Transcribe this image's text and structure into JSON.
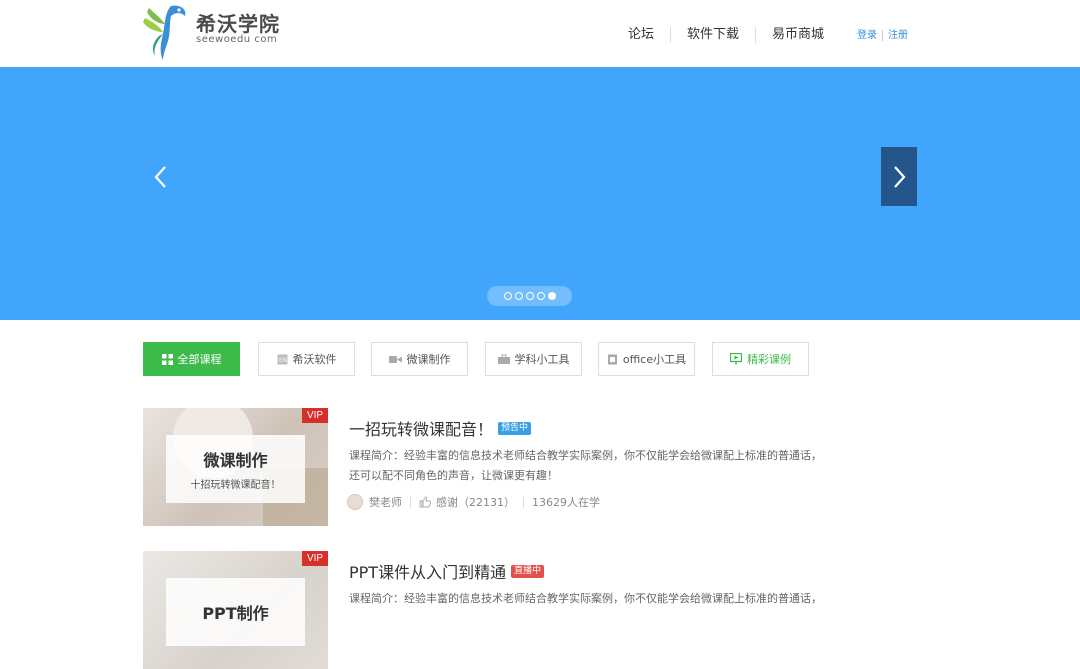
{
  "header": {
    "logo_text": "希沃学院",
    "logo_sub": "seewoedu com",
    "nav": [
      "论坛",
      "软件下载",
      "易币商城"
    ],
    "login": "登录",
    "register": "注册"
  },
  "banner": {
    "bg_color": "#41a5fc",
    "dots_total": 5,
    "active_dot": 5
  },
  "tabs": [
    {
      "label": "全部课程",
      "icon": "grid-icon",
      "active": true
    },
    {
      "label": "希沃软件",
      "icon": "easinote-icon"
    },
    {
      "label": "微课制作",
      "icon": "video-camera-icon"
    },
    {
      "label": "学科小工具",
      "icon": "toolbox-icon"
    },
    {
      "label": "office小工具",
      "icon": "office-icon"
    },
    {
      "label": "精彩课例",
      "icon": "presentation-icon"
    }
  ],
  "courses": [
    {
      "thumb_title": "微课制作",
      "thumb_sub": "十招玩转微课配音！",
      "vip": "VIP",
      "title": "一招玩转微课配音！",
      "badge": "预告中",
      "badge_color": "#3a9ee6",
      "desc": "课程简介：经验丰富的信息技术老师结合教学实际案例，你不仅能学会给微课配上标准的普通话，还可以配不同角色的声音，让微课更有趣！",
      "teacher": "樊老师",
      "thanks": "感谢（22131）",
      "learners": "13629人在学"
    },
    {
      "thumb_title": "PPT制作",
      "thumb_sub": "",
      "vip": "VIP",
      "title": "PPT课件从入门到精通",
      "badge": "直播中",
      "badge_color": "#e2514c",
      "desc": "课程简介：经验丰富的信息技术老师结合教学实际案例，你不仅能学会给微课配上标准的普通话，",
      "teacher": "",
      "thanks": "",
      "learners": ""
    }
  ]
}
